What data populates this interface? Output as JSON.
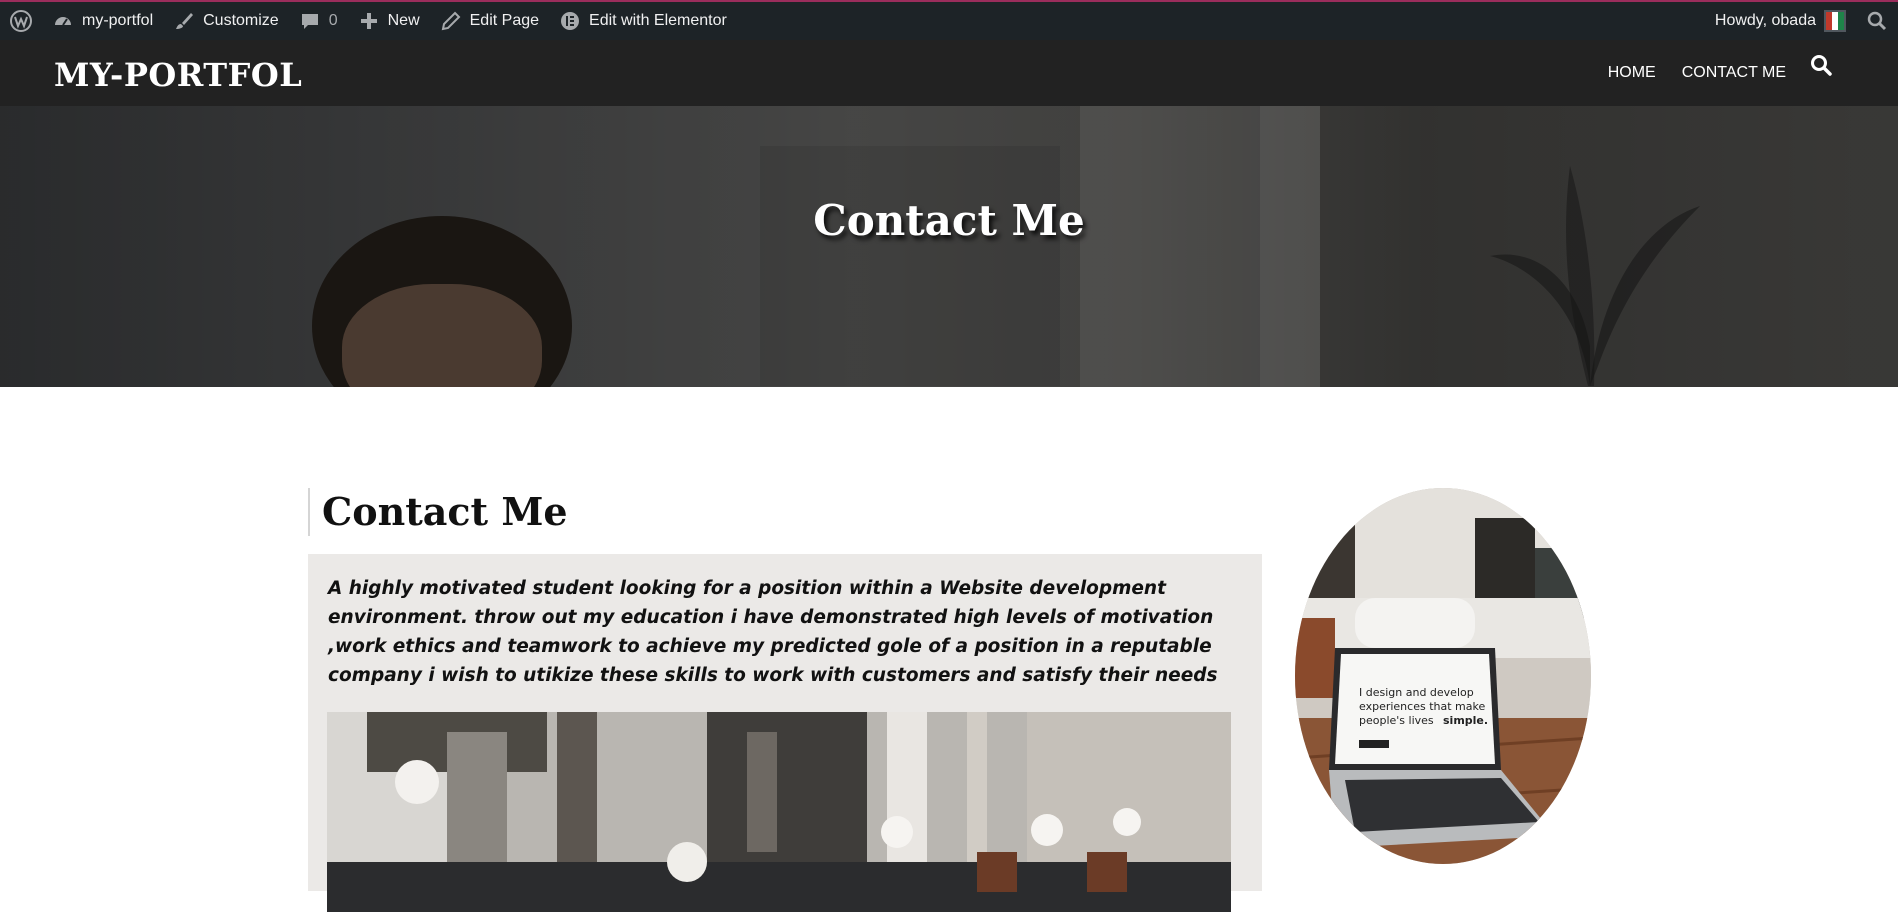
{
  "admin_bar": {
    "site_name": "my-portfol",
    "customize": "Customize",
    "comments_count": "0",
    "new": "New",
    "edit_page": "Edit Page",
    "edit_elementor": "Edit with Elementor",
    "greeting": "Howdy, obada"
  },
  "header": {
    "site_title": "MY-PORTFOL",
    "nav": [
      "HOME",
      "CONTACT ME"
    ]
  },
  "hero": {
    "title": "Contact Me"
  },
  "content": {
    "heading": "Contact Me",
    "paragraph": "A highly motivated student looking for a position within a Website development environment. throw out my education i have demonstrated high levels of motivation ,work ethics and teamwork to achieve my predicted gole of a position in a reputable company i wish to utikize these skills to work with customers and satisfy their needs"
  },
  "sidebar": {
    "laptop_text_line1": "I design and develop",
    "laptop_text_line2": "experiences that make",
    "laptop_text_line3": "people's lives",
    "laptop_text_bold": "simple."
  },
  "colors": {
    "admin_bar_bg": "#1d2327",
    "header_bg": "#222222",
    "content_box_bg": "#ebe9e7",
    "accent": "#9b2d5c"
  },
  "icons": [
    "wordpress-icon",
    "dashboard-icon",
    "brush-icon",
    "comment-icon",
    "plus-icon",
    "pencil-icon",
    "elementor-icon",
    "search-icon"
  ]
}
